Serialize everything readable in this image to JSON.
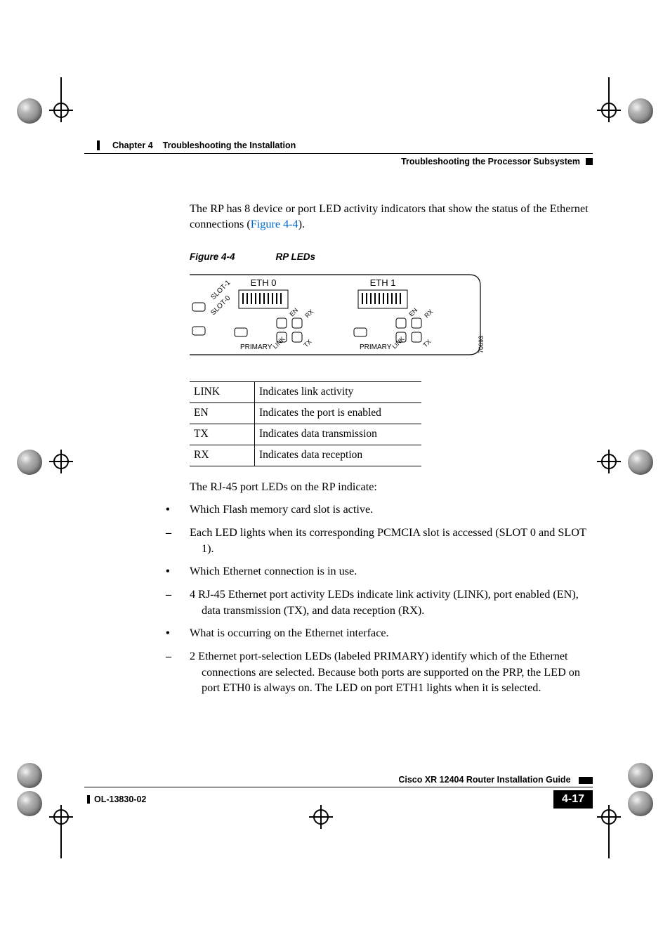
{
  "header": {
    "chapter_label": "Chapter 4",
    "chapter_title": "Troubleshooting the Installation",
    "section_title": "Troubleshooting the Processor Subsystem"
  },
  "intro_paragraph": "The RP has 8 device or port LED activity indicators that show the status of the Ethernet connections (",
  "intro_link": "Figure 4-4",
  "intro_tail": ").",
  "figure": {
    "ref": "Figure 4-4",
    "title": "RP LEDs",
    "labels": {
      "eth0": "ETH 0",
      "eth1": "ETH 1",
      "slot1": "SLOT-1",
      "slot0": "SLOT-0",
      "primary": "PRIMARY",
      "link": "LINK",
      "en": "EN",
      "tx": "TX",
      "rx": "RX",
      "art_id": "70693"
    }
  },
  "led_table": [
    {
      "abbr": "LINK",
      "desc": "Indicates link activity"
    },
    {
      "abbr": "EN",
      "desc": "Indicates the port is enabled"
    },
    {
      "abbr": "TX",
      "desc": "Indicates data transmission"
    },
    {
      "abbr": "RX",
      "desc": "Indicates data reception"
    }
  ],
  "after_table_intro": "The RJ-45 port LEDs on the RP indicate:",
  "bullets": [
    {
      "text": "Which Flash memory card slot is active.",
      "sub": [
        "Each LED lights when its corresponding PCMCIA slot is accessed (SLOT 0 and SLOT 1)."
      ]
    },
    {
      "text": "Which Ethernet connection is in use.",
      "sub": [
        "4 RJ-45 Ethernet port activity LEDs indicate link activity (LINK), port enabled (EN), data transmission (TX), and data reception (RX)."
      ]
    },
    {
      "text": "What is occurring on the Ethernet interface.",
      "sub": [
        "2 Ethernet port-selection LEDs (labeled PRIMARY) identify which of the Ethernet connections are selected. Because both ports are supported on the PRP, the LED on port ETH0 is always on. The LED on port ETH1 lights when it is selected."
      ]
    }
  ],
  "footer": {
    "guide_title": "Cisco XR 12404 Router Installation Guide",
    "doc_id": "OL-13830-02",
    "page_number": "4-17"
  }
}
